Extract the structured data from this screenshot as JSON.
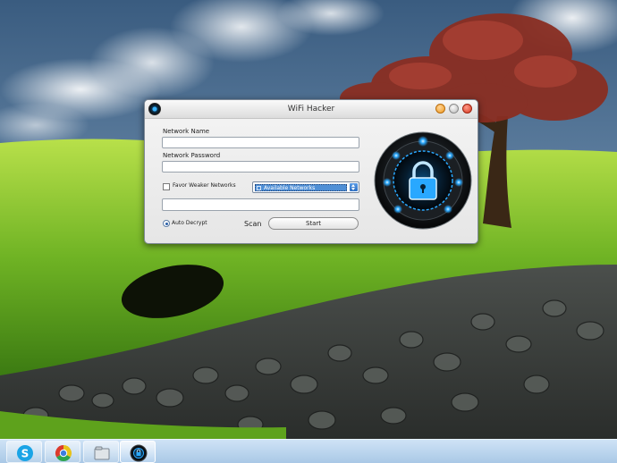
{
  "window": {
    "title": "WiFi Hacker",
    "icon": "wifi-hacker-app-icon"
  },
  "form": {
    "network_name_label": "Network Name",
    "network_name_value": "",
    "network_password_label": "Network Password",
    "network_password_value": "",
    "favor_weaker_label": "Favor Weaker Networks",
    "favor_weaker_checked": false,
    "networks_dropdown_selected": "Available Networks",
    "status_value": "",
    "auto_decrypt_label": "Auto Decrypt",
    "auto_decrypt_selected": true,
    "scan_label": "Scan",
    "start_label": "Start"
  },
  "graphic": {
    "icon": "padlock-icon",
    "accent_color": "#29a8ff"
  },
  "taskbar": {
    "items": [
      {
        "icon": "skype-icon"
      },
      {
        "icon": "chrome-icon"
      },
      {
        "icon": "file-explorer-icon"
      },
      {
        "icon": "wifi-hacker-app-icon",
        "active": true
      }
    ]
  },
  "colors": {
    "taskbar": "#b9d4ee",
    "selection": "#4f8fd6",
    "close_button": "#d8381e",
    "minimize_button": "#f09a1c"
  }
}
